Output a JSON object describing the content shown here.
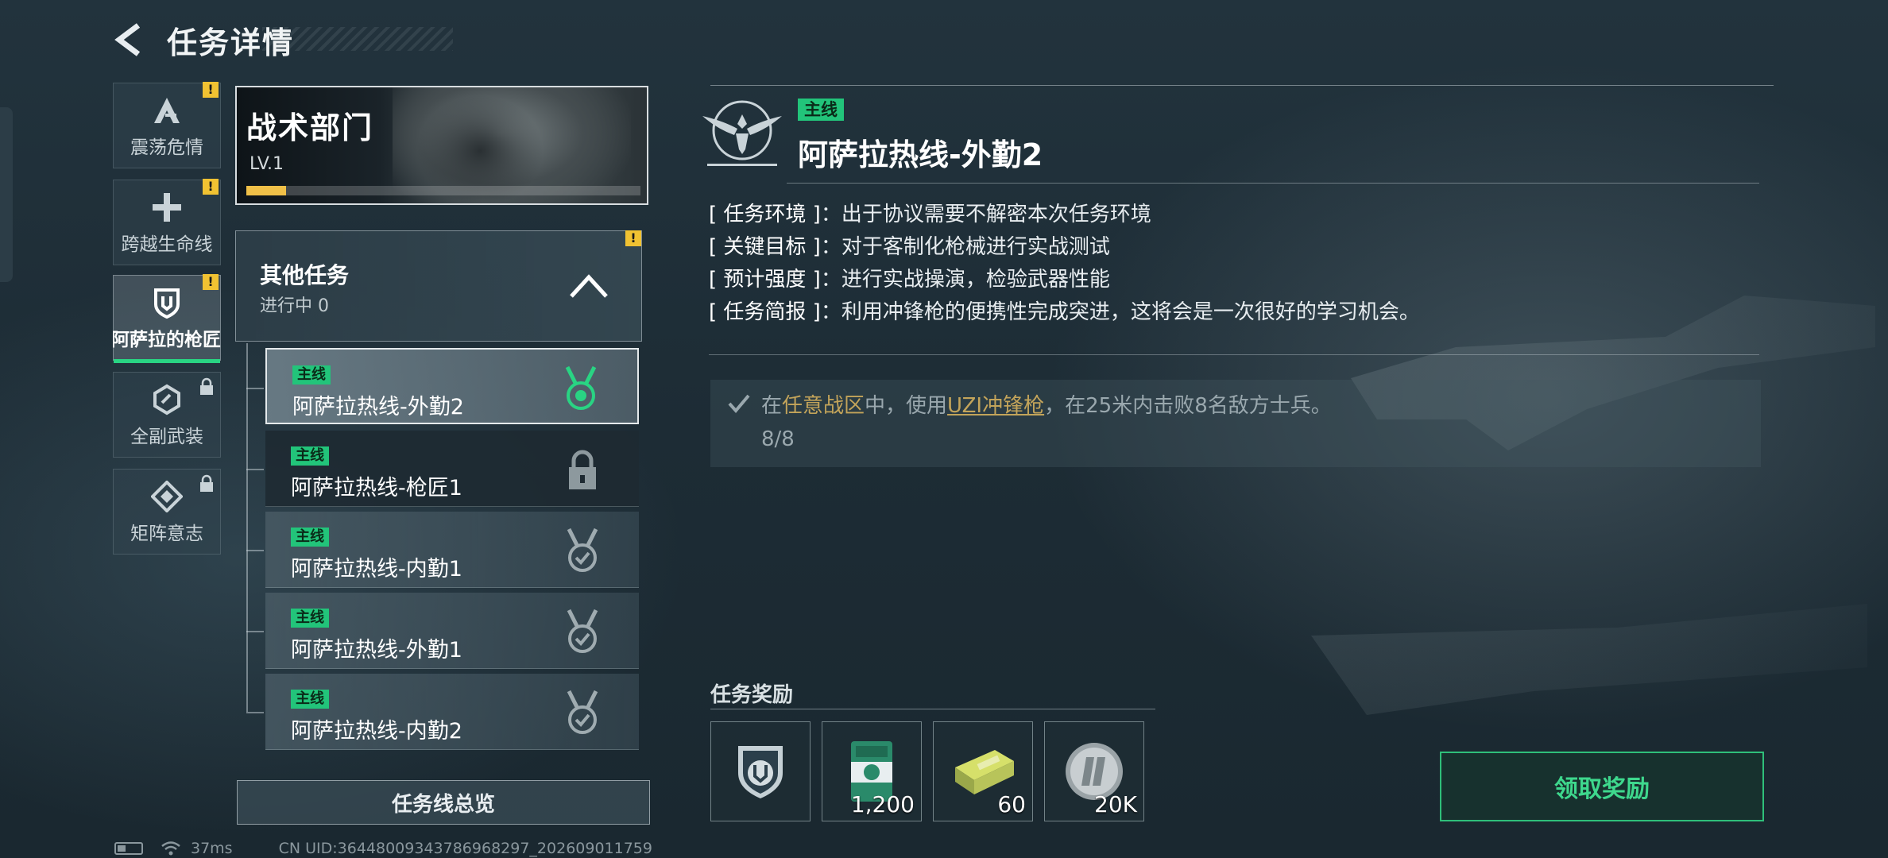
{
  "header": {
    "title": "任务详情"
  },
  "categories": [
    {
      "label": "震荡危情",
      "icon": "a-chevron-icon",
      "alert": "!"
    },
    {
      "label": "跨越生命线",
      "icon": "cross-icon",
      "alert": "!"
    },
    {
      "label": "阿萨拉的枪匠",
      "icon": "shield-icon",
      "alert": "!",
      "active": true
    },
    {
      "label": "全副武装",
      "icon": "hex-icon",
      "locked": true
    },
    {
      "label": "矩阵意志",
      "icon": "diamond-icon",
      "locked": true
    }
  ],
  "faction": {
    "name": "战术部门",
    "level": "LV.1",
    "progress": 0.1
  },
  "other_tasks": {
    "title": "其他任务",
    "subtitle": "进行中 0",
    "alert": "!"
  },
  "tasks": [
    {
      "tag": "主线",
      "name": "阿萨拉热线-外勤2",
      "state": "in-progress"
    },
    {
      "tag": "主线",
      "name": "阿萨拉热线-枪匠1",
      "state": "locked"
    },
    {
      "tag": "主线",
      "name": "阿萨拉热线-内勤1",
      "state": "done"
    },
    {
      "tag": "主线",
      "name": "阿萨拉热线-外勤1",
      "state": "done"
    },
    {
      "tag": "主线",
      "name": "阿萨拉热线-内勤2",
      "state": "done"
    }
  ],
  "overview_button": "任务线总览",
  "detail": {
    "tag": "主线",
    "title": "阿萨拉热线-外勤2",
    "info": [
      {
        "key": "[ 任务环境 ]",
        "value": "出于协议需要不解密本次任务环境"
      },
      {
        "key": "[ 关键目标 ]",
        "value": "对于客制化枪械进行实战测试"
      },
      {
        "key": "[ 预计强度 ]",
        "value": "进行实战操演，检验武器性能"
      },
      {
        "key": "[ 任务简报 ]",
        "value": "利用冲锋枪的便携性完成突进，这将会是一次很好的学习机会。"
      }
    ],
    "objective": {
      "pre": "在",
      "zone": "任意战区",
      "mid": "中，使用",
      "weapon": "UZI冲锋枪",
      "post": "，在25米内击败8名敌方士兵。",
      "progress": "8/8"
    }
  },
  "rewards": {
    "title": "任务奖励",
    "items": [
      {
        "icon": "shield-badge-icon",
        "qty": ""
      },
      {
        "icon": "supply-case-icon",
        "qty": "1,200"
      },
      {
        "icon": "ammo-box-icon",
        "qty": "60"
      },
      {
        "icon": "coin-icon",
        "qty": "20K"
      }
    ],
    "claim_label": "领取奖励"
  },
  "status_bar": {
    "ping": "37ms",
    "uid": "CN UID:36448009343786968297_202609011759"
  },
  "colors": {
    "accent_green": "#22c47a",
    "alert_yellow": "#f1c232",
    "highlight_gold": "#c3a45a"
  }
}
